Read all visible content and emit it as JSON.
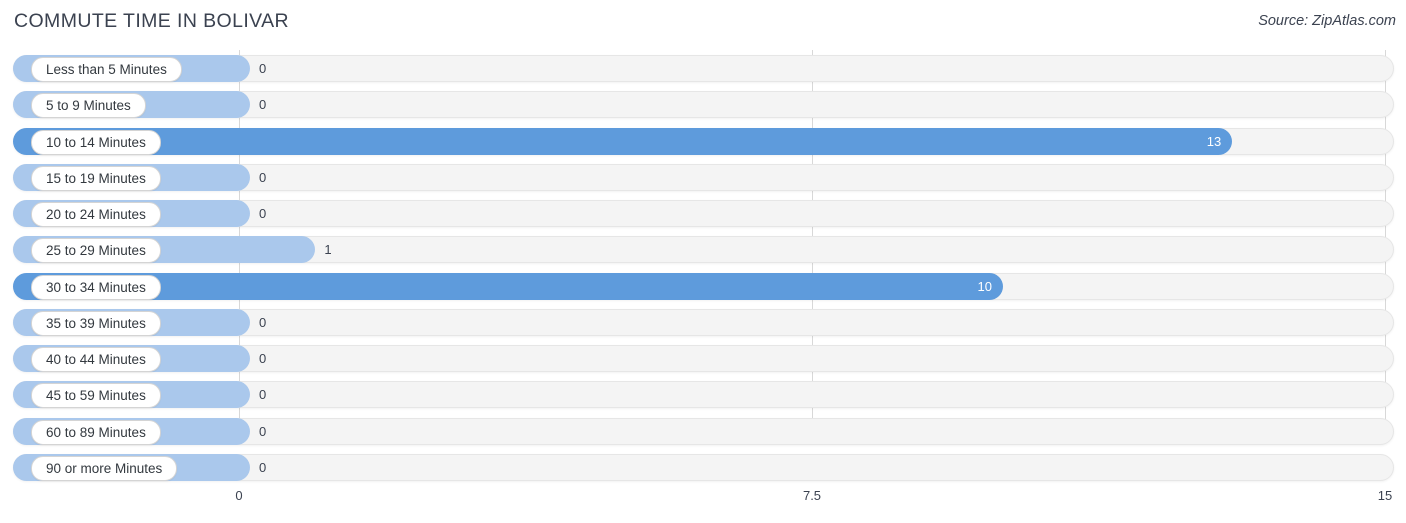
{
  "header": {
    "title": "COMMUTE TIME IN BOLIVAR",
    "source": "Source: ZipAtlas.com"
  },
  "colors": {
    "bar_light": "#aac8ec",
    "bar_dark": "#5e9bdc",
    "track": "#f4f4f4",
    "gridline": "#d8d8d8",
    "text": "#3b4250"
  },
  "chart_data": {
    "type": "bar",
    "orientation": "horizontal",
    "title": "COMMUTE TIME IN BOLIVAR",
    "xlabel": "",
    "ylabel": "",
    "xlim": [
      0,
      15
    ],
    "xticks": [
      0,
      7.5,
      15
    ],
    "xtick_labels": [
      "0",
      "7.5",
      "15"
    ],
    "grid": true,
    "legend": "none",
    "categories": [
      "Less than 5 Minutes",
      "5 to 9 Minutes",
      "10 to 14 Minutes",
      "15 to 19 Minutes",
      "20 to 24 Minutes",
      "25 to 29 Minutes",
      "30 to 34 Minutes",
      "35 to 39 Minutes",
      "40 to 44 Minutes",
      "45 to 59 Minutes",
      "60 to 89 Minutes",
      "90 or more Minutes"
    ],
    "values": [
      0,
      0,
      13,
      0,
      0,
      1,
      10,
      0,
      0,
      0,
      0,
      0
    ],
    "value_labels": [
      "0",
      "0",
      "13",
      "0",
      "0",
      "1",
      "10",
      "0",
      "0",
      "0",
      "0",
      "0"
    ]
  }
}
